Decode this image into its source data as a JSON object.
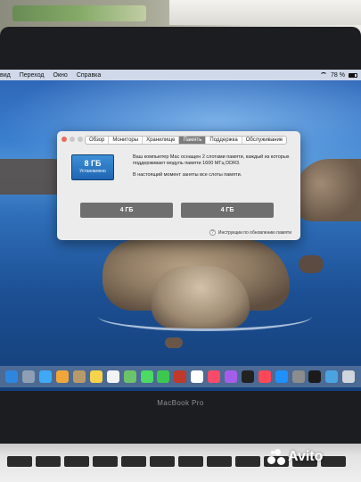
{
  "menubar": {
    "items": [
      "вид",
      "Переход",
      "Окно",
      "Справка"
    ],
    "battery": "78 %"
  },
  "dialog": {
    "tabs": [
      "Обзор",
      "Мониторы",
      "Хранилище",
      "Память",
      "Поддержка",
      "Обслуживание"
    ],
    "active_tab_index": 3,
    "memory_total": "8 ГБ",
    "memory_status": "Установлено",
    "description": "Ваш компьютер Mac оснащен 2 слотами памяти, каждый из которых поддерживает модуль памяти 1600 МГц DDR3.",
    "slots_note": "В настоящий момент заняты все слоты памяти.",
    "slots": [
      "4 ГБ",
      "4 ГБ"
    ],
    "instructions_link": "Инструкции по обновлению памяти"
  },
  "dock": {
    "icons": [
      {
        "name": "finder-icon",
        "color": "#2e86de"
      },
      {
        "name": "launchpad-icon",
        "color": "#8e9fb5"
      },
      {
        "name": "safari-icon",
        "color": "#3fa9f5"
      },
      {
        "name": "photos-icon",
        "color": "#f0a63a"
      },
      {
        "name": "contacts-icon",
        "color": "#b89a6a"
      },
      {
        "name": "notes-icon",
        "color": "#f6d34b"
      },
      {
        "name": "reminders-icon",
        "color": "#f3f3f3"
      },
      {
        "name": "maps-icon",
        "color": "#6cc36a"
      },
      {
        "name": "messages-icon",
        "color": "#4cd964"
      },
      {
        "name": "facetime-icon",
        "color": "#3cc84f"
      },
      {
        "name": "photobooth-icon",
        "color": "#c0392b"
      },
      {
        "name": "calendar-icon",
        "color": "#ffffff"
      },
      {
        "name": "music-icon",
        "color": "#fa4a67"
      },
      {
        "name": "podcasts-icon",
        "color": "#a55eea"
      },
      {
        "name": "tv-icon",
        "color": "#222222"
      },
      {
        "name": "news-icon",
        "color": "#ff4757"
      },
      {
        "name": "appstore-icon",
        "color": "#1e90ff"
      },
      {
        "name": "system-preferences-icon",
        "color": "#8c8c8c"
      },
      {
        "name": "activity-monitor-icon",
        "color": "#1b1b1b"
      },
      {
        "name": "downloads-icon",
        "color": "#4aa3df"
      },
      {
        "name": "trash-icon",
        "color": "#cfd6de"
      }
    ]
  },
  "brand": "MacBook Pro",
  "watermark": "Avito"
}
